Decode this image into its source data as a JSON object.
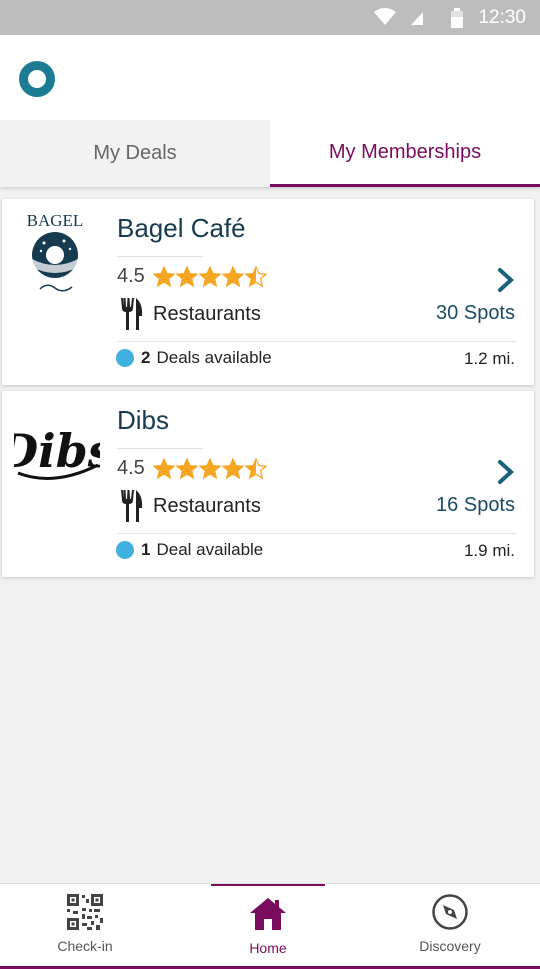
{
  "status_bar": {
    "time": "12:30"
  },
  "tabs": [
    {
      "label": "My Deals",
      "active": false
    },
    {
      "label": "My Memberships",
      "active": true
    }
  ],
  "memberships": [
    {
      "name": "Bagel Café",
      "logo": "BAGEL",
      "rating": "4.5",
      "rating_value": 4.5,
      "category": "Restaurants",
      "category_icon": "fork-knife-icon",
      "spots": "30 Spots",
      "deals_count": "2",
      "deals_label": "Deals available",
      "distance": "1.2 mi."
    },
    {
      "name": "Dibs",
      "logo": "Dibs",
      "rating": "4.5",
      "rating_value": 4.5,
      "category": "Restaurants",
      "category_icon": "fork-knife-icon",
      "spots": "16 Spots",
      "deals_count": "1",
      "deals_label": "Deal available",
      "distance": "1.9 mi."
    }
  ],
  "bottom_nav": {
    "checkin": "Check-in",
    "home": "Home",
    "discovery": "Discovery"
  },
  "colors": {
    "accent": "#7a0c5e",
    "teal": "#1b7c93",
    "star": "#f5a623",
    "deal_dot": "#40b0e0",
    "title": "#163b50"
  }
}
